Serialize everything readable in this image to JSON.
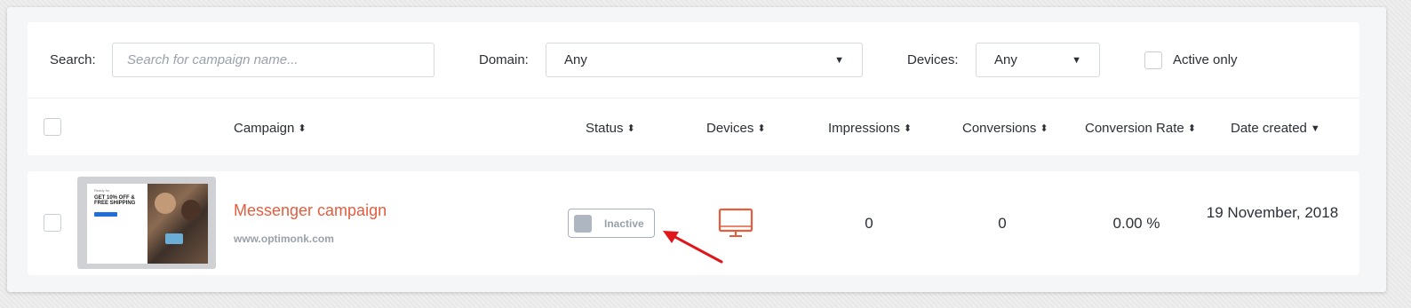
{
  "filters": {
    "search_label": "Search:",
    "search_placeholder": "Search for campaign name...",
    "domain_label": "Domain:",
    "domain_value": "Any",
    "devices_label": "Devices:",
    "devices_value": "Any",
    "active_only_label": "Active only"
  },
  "table": {
    "columns": [
      "Campaign",
      "Status",
      "Devices",
      "Impressions",
      "Conversions",
      "Conversion Rate",
      "Date created"
    ],
    "sort_icons": [
      "sort-both",
      "sort-both",
      "sort-both",
      "sort-both",
      "sort-both",
      "sort-both",
      "sort-down"
    ],
    "rows": [
      {
        "thumbnail": {
          "small_line": "Ready for",
          "headline_1": "GET 10% OFF &",
          "headline_2": "FREE SHIPPING"
        },
        "name": "Messenger campaign",
        "domain": "www.optimonk.com",
        "status": "Inactive",
        "device_icon": "desktop-icon",
        "impressions": "0",
        "conversions": "0",
        "conversion_rate": "0.00 %",
        "date_created": "19 November, 2018"
      }
    ]
  },
  "colors": {
    "accent": "#e35d3e",
    "annotation_arrow": "#e0161b",
    "status_inactive": "#aeb6c1"
  }
}
